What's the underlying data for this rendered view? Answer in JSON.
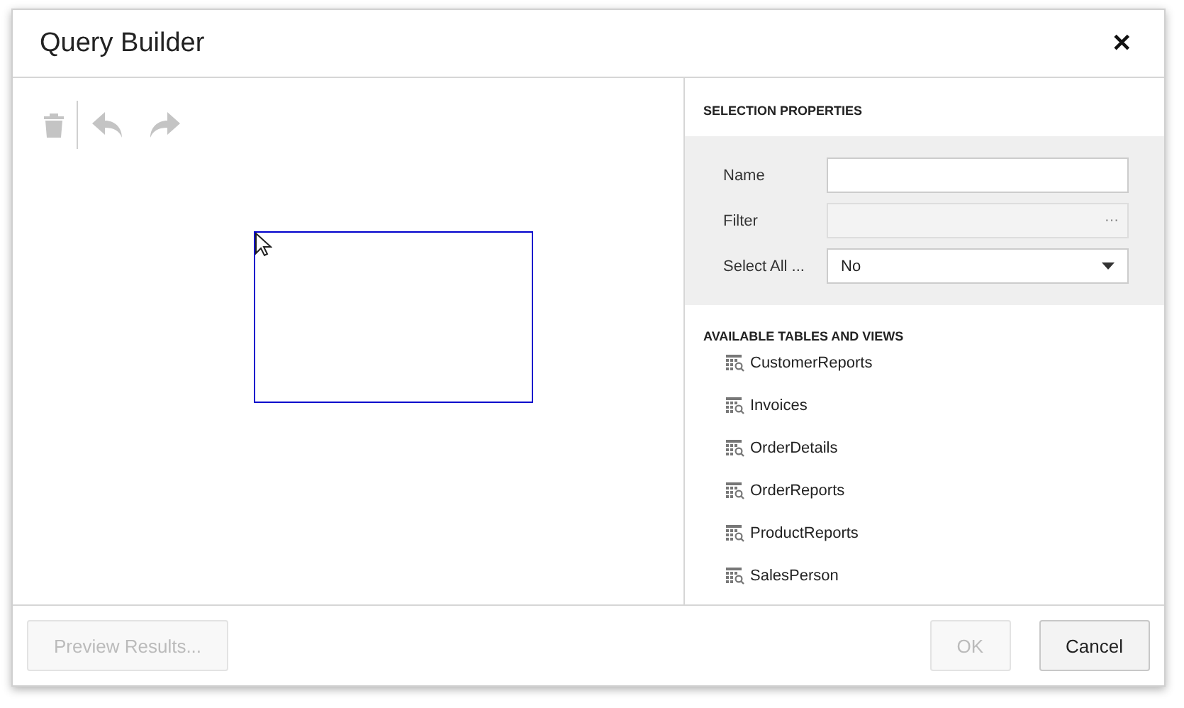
{
  "window": {
    "title": "Query Builder",
    "close": "✕"
  },
  "toolbar": [
    {
      "kind": "delete",
      "disabled": true
    },
    {
      "kind": "undo",
      "disabled": true
    },
    {
      "kind": "redo",
      "disabled": true
    }
  ],
  "selection_properties": {
    "heading": "SELECTION PROPERTIES",
    "fields": [
      {
        "kind": "text",
        "label": "Name",
        "disabled": false
      },
      {
        "kind": "ellipsis",
        "label": "Filter",
        "button": "···",
        "disabled": true
      },
      {
        "kind": "select",
        "label": "Select All ...",
        "value": "No",
        "disabled": false
      }
    ]
  },
  "tables": {
    "heading": "AVAILABLE TABLES AND VIEWS",
    "items": [
      "CustomerReports",
      "Invoices",
      "OrderDetails",
      "OrderReports",
      "ProductReports",
      "SalesPerson"
    ]
  },
  "footer": {
    "left_buttons": [
      {
        "label": "Preview Results...",
        "disabled": true
      }
    ],
    "right_buttons": [
      {
        "label": "OK",
        "disabled": true
      },
      {
        "label": "Cancel",
        "disabled": false
      }
    ]
  }
}
